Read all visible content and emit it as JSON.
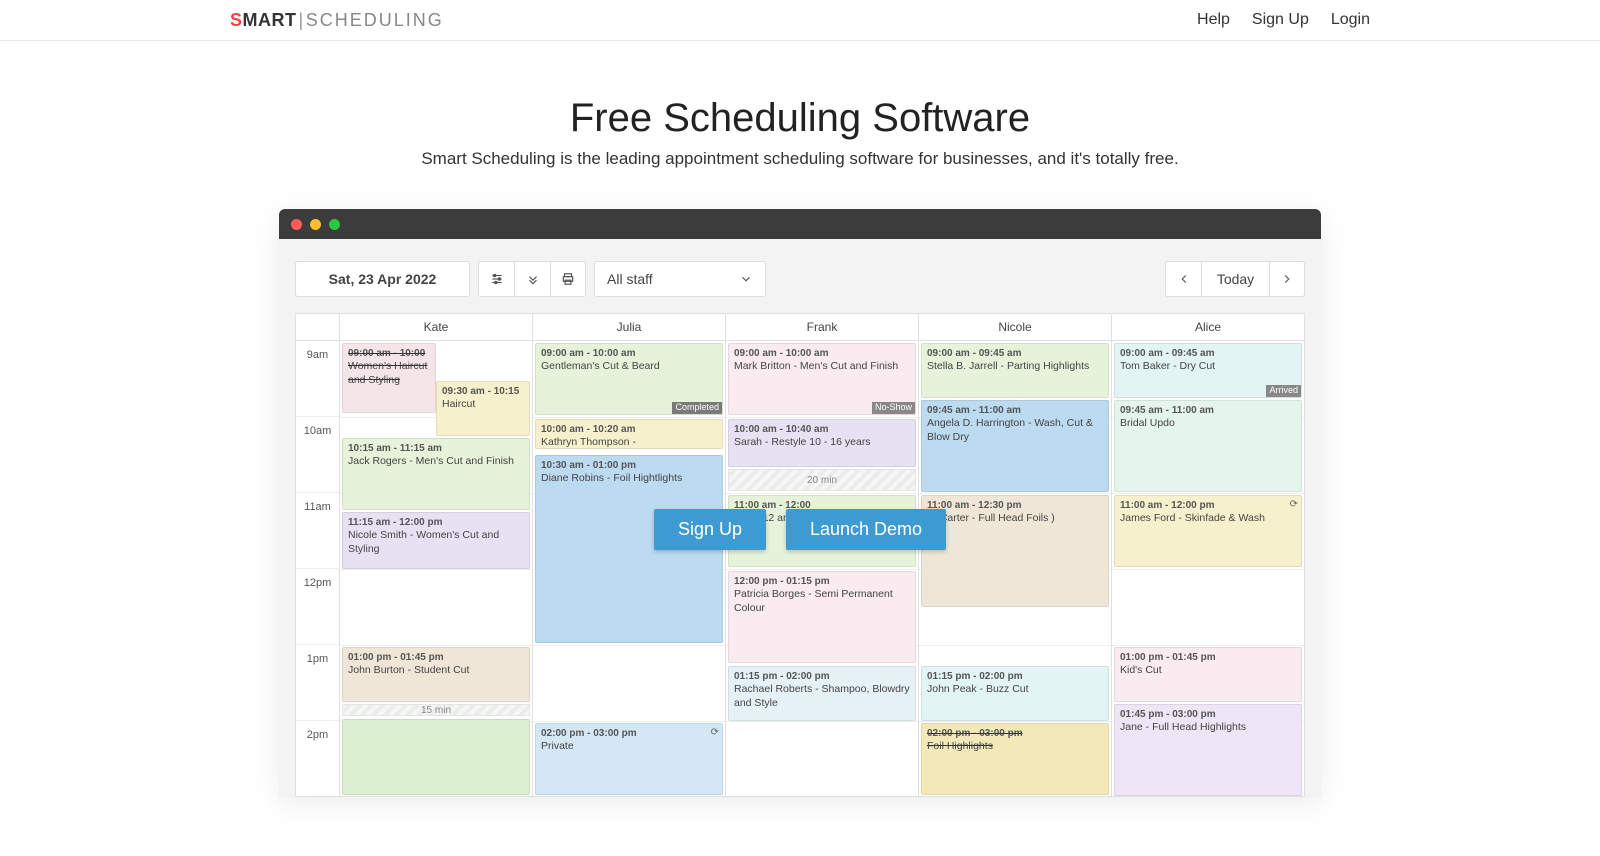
{
  "header": {
    "logo_smart": "SMART",
    "logo_sched": "SCHEDULING",
    "nav": {
      "help": "Help",
      "signup": "Sign Up",
      "login": "Login"
    }
  },
  "hero": {
    "title": "Free Scheduling Software",
    "subtitle": "Smart Scheduling is the leading appointment scheduling software for businesses, and it's totally free."
  },
  "toolbar": {
    "date": "Sat, 23 Apr 2022",
    "staff": "All staff",
    "today": "Today"
  },
  "cta": {
    "signup": "Sign Up",
    "demo": "Launch Demo"
  },
  "columns": [
    "Kate",
    "Julia",
    "Frank",
    "Nicole",
    "Alice"
  ],
  "time_labels": [
    "9am",
    "10am",
    "11am",
    "12pm",
    "1pm",
    "2pm"
  ],
  "badges": {
    "completed": "Completed",
    "noshow": "No-Show",
    "arrived": "Arrived"
  },
  "gaps": {
    "g20": "20 min",
    "g15": "15 min"
  },
  "events": {
    "kate": [
      {
        "time": "09:00 am - 10:00",
        "desc": "Women's Haircut and Styling"
      },
      {
        "time": "09:30 am - 10:15",
        "desc": "Haircut"
      },
      {
        "time": "10:15 am - 11:15 am",
        "desc": "Jack Rogers - Men's Cut and Finish"
      },
      {
        "time": "11:15 am - 12:00 pm",
        "desc": "Nicole Smith - Women's Cut and Styling"
      },
      {
        "time": "01:00 pm - 01:45 pm",
        "desc": "John Burton - Student Cut"
      },
      {
        "time": "",
        "desc": ""
      }
    ],
    "julia": [
      {
        "time": "09:00 am - 10:00 am",
        "desc": "Gentleman's Cut & Beard"
      },
      {
        "time": "10:00 am - 10:20 am",
        "desc": "Kathryn Thompson -"
      },
      {
        "time": "10:30 am - 01:00 pm",
        "desc": "Diane Robins - Foil Hightlights"
      },
      {
        "time": "02:00 pm - 03:00 pm",
        "desc": "Private"
      }
    ],
    "frank": [
      {
        "time": "09:00 am - 10:00 am",
        "desc": "Mark Britton - Men's Cut and Finish"
      },
      {
        "time": "10:00 am - 10:40 am",
        "desc": "Sarah - Restyle 10 - 16 years"
      },
      {
        "time": "11:00 am - 12:00",
        "desc": "t Cut (12 and"
      },
      {
        "time": "12:00 pm - 01:15 pm",
        "desc": "Patricia Borges - Semi Permanent Colour"
      },
      {
        "time": "01:15 pm - 02:00 pm",
        "desc": "Rachael Roberts - Shampoo, Blowdry and Style"
      }
    ],
    "nicole": [
      {
        "time": "09:00 am - 09:45 am",
        "desc": "Stella B. Jarrell - Parting Highlights"
      },
      {
        "time": "09:45 am - 11:00 am",
        "desc": "Angela D. Harrington - Wash, Cut & Blow Dry"
      },
      {
        "time": "11:00 am - 12:30 pm",
        "desc": "A. Carter - Full Head Foils )"
      },
      {
        "time": "01:15 pm - 02:00 pm",
        "desc": "John Peak - Buzz Cut"
      },
      {
        "time": "02:00 pm - 03:00 pm",
        "desc": "Foil Highlights"
      }
    ],
    "alice": [
      {
        "time": "09:00 am - 09:45 am",
        "desc": "Tom Baker - Dry Cut"
      },
      {
        "time": "09:45 am - 11:00 am",
        "desc": "Bridal Updo"
      },
      {
        "time": "11:00 am - 12:00 pm",
        "desc": "James Ford - Skinfade & Wash"
      },
      {
        "time": "01:00 pm - 01:45 pm",
        "desc": "Kid's Cut"
      },
      {
        "time": "01:45 pm - 03:00 pm",
        "desc": "Jane - Full Head Highlights"
      }
    ]
  }
}
